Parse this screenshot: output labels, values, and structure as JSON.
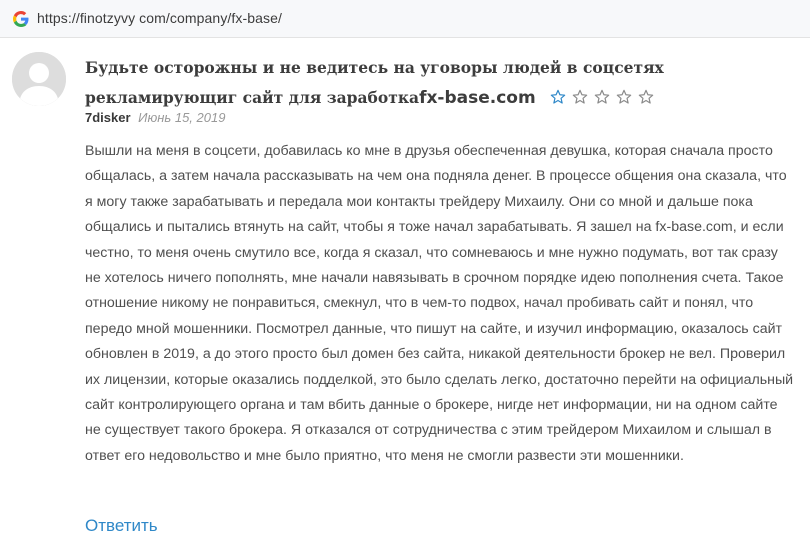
{
  "browser": {
    "url": "https://finotzyvy com/company/fx-base/"
  },
  "review": {
    "title": "Будьте осторожны и не ведитесь на уговоры людей в соцсетях рекламирующиг сайт для заработка",
    "title_domain": "fx-base.com",
    "rating": 1,
    "rating_max": 5,
    "author": "7disker",
    "date": "Июнь 15, 2019",
    "body": "Вышли на меня в соцсети, добавилась ко мне в друзья обеспеченная девушка, которая сначала просто общалась, а затем начала рассказывать на чем она подняла денег. В процессе общения она сказала, что я могу также зарабатывать и передала мои контакты трейдеру Михаилу. Они со мной и дальше пока общались и пытались втянуть на сайт, чтобы я тоже начал зарабатывать. Я зашел на fx-base.com, и если честно, то меня очень смутило все, когда я сказал, что сомневаюсь и мне нужно подумать, вот так сразу не хотелось ничего пополнять, мне начали навязывать в срочном порядке идею пополнения счета. Такое отношение никому не понравиться, смекнул, что в чем-то подвох, начал пробивать сайт и понял, что передо мной мошенники. Посмотрел данные, что пишут на сайте, и изучил информацию, оказалось сайт обновлен в 2019, а до этого просто был домен без сайта, никакой деятельности брокер не вел. Проверил их лицензии, которые оказались подделкой, это было сделать легко, достаточно перейти на официальный сайт контролирующего органа и там вбить данные о брокере, нигде нет информации, ни на одном сайте не существует такого брокера. Я отказался от сотрудничества с этим трейдером Михаилом и слышал в ответ его недовольство и мне было приятно, что меня не смогли развести эти мошенники.",
    "reply_label": "Ответить"
  },
  "colors": {
    "star_filled": "#2f88c8",
    "star_empty": "#8a8a8a",
    "link": "#2f88c8"
  }
}
